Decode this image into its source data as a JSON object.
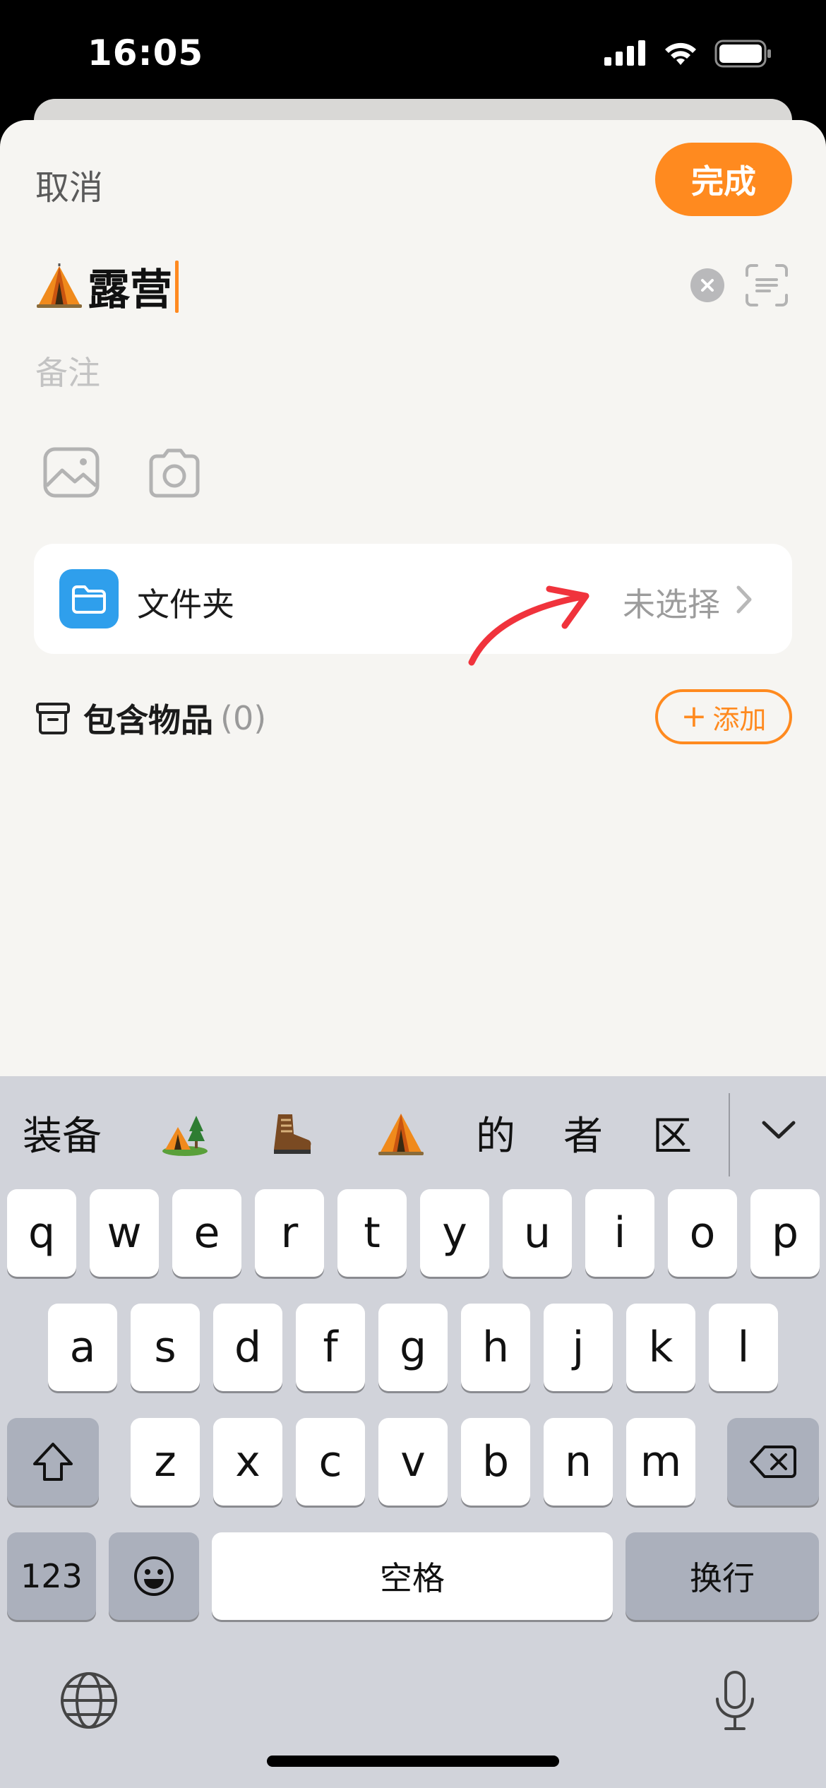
{
  "status": {
    "time": "16:05"
  },
  "header": {
    "cancel_label": "取消",
    "done_label": "完成"
  },
  "title": {
    "value": "露营"
  },
  "note": {
    "placeholder": "备注"
  },
  "folder": {
    "label": "文件夹",
    "value": "未选择"
  },
  "items": {
    "label": "包含物品",
    "count": "(0)",
    "add_label": "添加"
  },
  "candidates": [
    "装备",
    "的",
    "者",
    "区"
  ],
  "keyboard": {
    "row1": [
      "q",
      "w",
      "e",
      "r",
      "t",
      "y",
      "u",
      "i",
      "o",
      "p"
    ],
    "row2": [
      "a",
      "s",
      "d",
      "f",
      "g",
      "h",
      "j",
      "k",
      "l"
    ],
    "row3": [
      "z",
      "x",
      "c",
      "v",
      "b",
      "n",
      "m"
    ],
    "numbers_label": "123",
    "space_label": "空格",
    "return_label": "换行"
  },
  "colors": {
    "accent": "#ff8a1f",
    "folder_blue": "#2f9fec",
    "annotation_red": "#f0333c"
  }
}
